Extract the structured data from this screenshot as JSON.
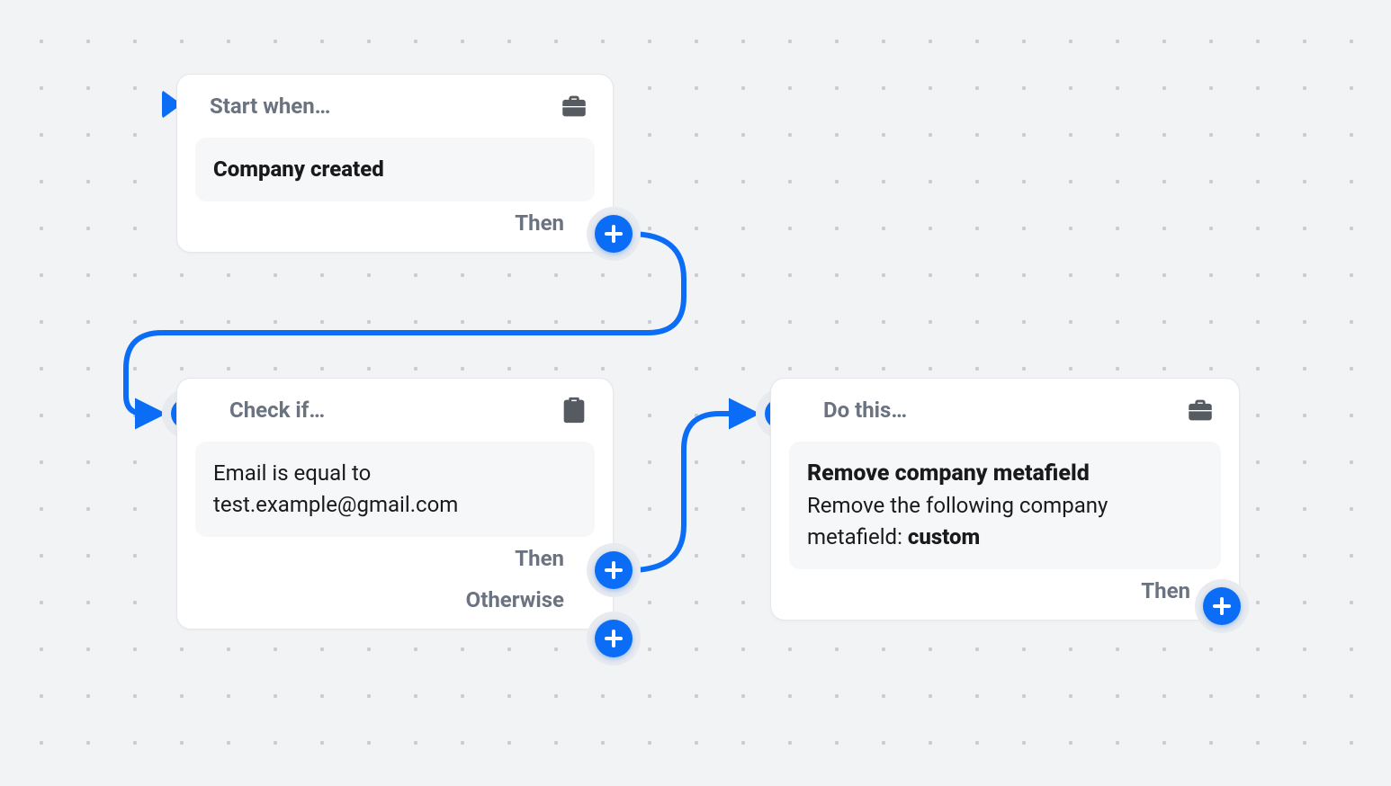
{
  "start": {
    "title": "Start when…",
    "event": "Company created",
    "then": "Then",
    "icon": "briefcase"
  },
  "condition": {
    "title": "Check if…",
    "rule": "Email is equal to test.example@gmail.com",
    "then": "Then",
    "otherwise": "Otherwise",
    "icon": "clipboard-check"
  },
  "action": {
    "title": "Do this…",
    "heading": "Remove company metafield",
    "description_prefix": "Remove the following company metafield: ",
    "description_bold": "custom",
    "then": "Then",
    "icon": "briefcase"
  }
}
